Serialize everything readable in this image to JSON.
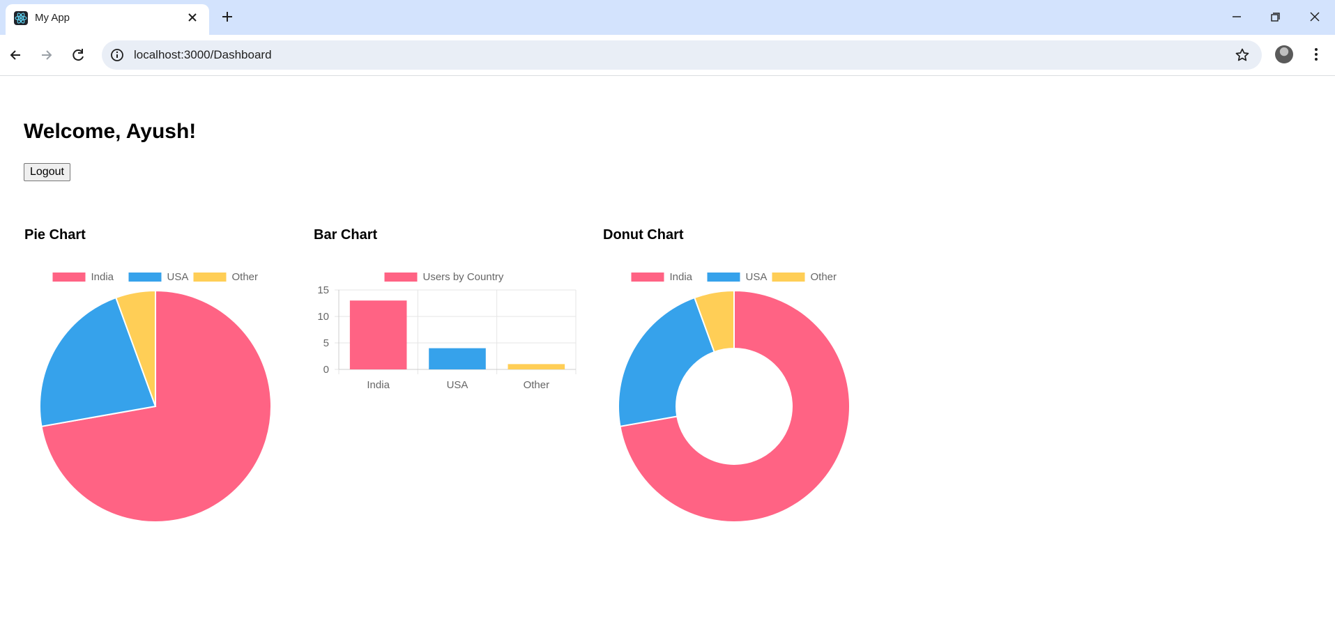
{
  "browser": {
    "tab_title": "My App",
    "url": "localhost:3000/Dashboard"
  },
  "page": {
    "welcome": "Welcome, Ayush!",
    "logout_label": "Logout"
  },
  "colors": {
    "india": "#ff6384",
    "usa": "#36a2eb",
    "other": "#ffce56"
  },
  "chart_data": [
    {
      "type": "pie",
      "title": "Pie Chart",
      "categories": [
        "India",
        "USA",
        "Other"
      ],
      "values": [
        13,
        4,
        1
      ],
      "legend_position": "top"
    },
    {
      "type": "bar",
      "title": "Bar Chart",
      "categories": [
        "India",
        "USA",
        "Other"
      ],
      "series": [
        {
          "name": "Users by Country",
          "values": [
            13,
            4,
            1
          ]
        }
      ],
      "ylim": [
        0,
        15
      ],
      "yticks": [
        0,
        5,
        10,
        15
      ],
      "grid": true,
      "legend_position": "top"
    },
    {
      "type": "donut",
      "title": "Donut Chart",
      "categories": [
        "India",
        "USA",
        "Other"
      ],
      "values": [
        13,
        4,
        1
      ],
      "legend_position": "top"
    }
  ]
}
